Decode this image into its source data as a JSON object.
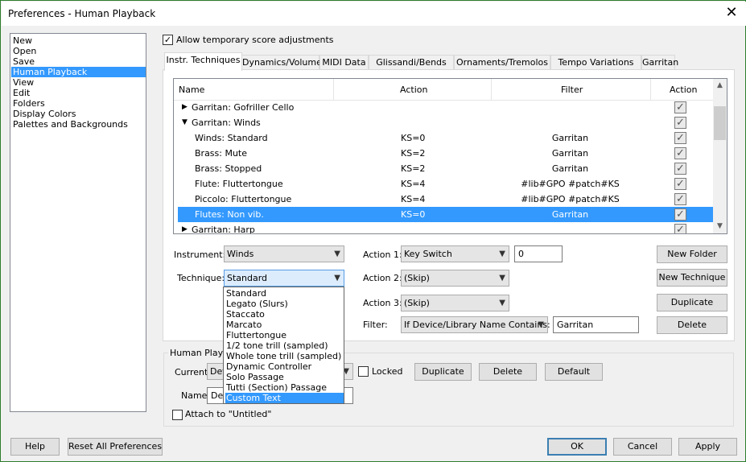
{
  "window": {
    "title": "Preferences - Human Playback",
    "close_icon": "close-icon"
  },
  "categories": [
    {
      "label": "New",
      "selected": false
    },
    {
      "label": "Open",
      "selected": false
    },
    {
      "label": "Save",
      "selected": false
    },
    {
      "label": "Human Playback",
      "selected": true
    },
    {
      "label": "View",
      "selected": false
    },
    {
      "label": "Edit",
      "selected": false
    },
    {
      "label": "Folders",
      "selected": false
    },
    {
      "label": "Display Colors",
      "selected": false
    },
    {
      "label": "Palettes and Backgrounds",
      "selected": false
    }
  ],
  "allow_temp": {
    "label": "Allow temporary score adjustments",
    "checked": true
  },
  "tabs": [
    {
      "label": "Instr. Techniques",
      "active": true
    },
    {
      "label": "Dynamics/Volume",
      "active": false
    },
    {
      "label": "MIDI Data",
      "active": false
    },
    {
      "label": "Glissandi/Bends",
      "active": false
    },
    {
      "label": "Ornaments/Tremolos",
      "active": false
    },
    {
      "label": "Tempo Variations",
      "active": false
    },
    {
      "label": "Garritan",
      "active": false
    }
  ],
  "grid": {
    "headers": {
      "name": "Name",
      "action": "Action",
      "filter": "Filter",
      "action2": "Action"
    },
    "rows": [
      {
        "expander": "▶",
        "name": "Garritan: Gofriller Cello",
        "action": "",
        "filter": "",
        "checked": true,
        "selected": false
      },
      {
        "expander": "▼",
        "name": "Garritan: Winds",
        "action": "",
        "filter": "",
        "checked": true,
        "selected": false
      },
      {
        "expander": "",
        "name": "Winds: Standard",
        "action": "KS=0",
        "filter": "Garritan",
        "checked": true,
        "selected": false
      },
      {
        "expander": "",
        "name": "Brass: Mute",
        "action": "KS=2",
        "filter": "Garritan",
        "checked": true,
        "selected": false
      },
      {
        "expander": "",
        "name": "Brass: Stopped",
        "action": "KS=2",
        "filter": "Garritan",
        "checked": true,
        "selected": false
      },
      {
        "expander": "",
        "name": "Flute: Fluttertongue",
        "action": "KS=4",
        "filter": "#lib#GPO #patch#KS",
        "checked": true,
        "selected": false
      },
      {
        "expander": "",
        "name": "Piccolo: Fluttertongue",
        "action": "KS=4",
        "filter": "#lib#GPO #patch#KS",
        "checked": true,
        "selected": false
      },
      {
        "expander": "",
        "name": "Flutes: Non vib.",
        "action": "KS=0",
        "filter": "Garritan",
        "checked": true,
        "selected": true
      },
      {
        "expander": "▶",
        "name": "Garritan: Harp",
        "action": "",
        "filter": "",
        "checked": true,
        "selected": false
      }
    ]
  },
  "form": {
    "instrument_label": "Instrument:",
    "instrument_value": "Winds",
    "technique_label": "Technique:",
    "technique_value": "Standard",
    "action1_label": "Action 1:",
    "action1_value": "Key Switch",
    "action1_number": "0",
    "action2_label": "Action 2:",
    "action2_value": "(Skip)",
    "action3_label": "Action 3:",
    "action3_value": "(Skip)",
    "filter_label": "Filter:",
    "filter_value": "If Device/Library Name Contains:",
    "filter_text": "Garritan",
    "new_folder": "New Folder",
    "new_technique": "New Technique",
    "duplicate": "Duplicate",
    "delete": "Delete"
  },
  "technique_options": [
    {
      "label": "Standard",
      "selected": false
    },
    {
      "label": "Legato (Slurs)",
      "selected": false
    },
    {
      "label": "Staccato",
      "selected": false
    },
    {
      "label": "Marcato",
      "selected": false
    },
    {
      "label": "Fluttertongue",
      "selected": false
    },
    {
      "label": "1/2 tone trill (sampled)",
      "selected": false
    },
    {
      "label": "Whole tone trill (sampled)",
      "selected": false
    },
    {
      "label": "Dynamic Controller",
      "selected": false
    },
    {
      "label": "Solo Passage",
      "selected": false
    },
    {
      "label": "Tutti (Section) Passage",
      "selected": false
    },
    {
      "label": "Custom Text",
      "selected": true
    }
  ],
  "style_group": {
    "title": "Human Playba",
    "current_label": "Current:",
    "current_value": "Def",
    "locked_label": "Locked",
    "duplicate": "Duplicate",
    "delete": "Delete",
    "default": "Default",
    "name_label": "Name:",
    "name_value": "Def",
    "attach_label": "Attach to \"Untitled\""
  },
  "footer": {
    "help": "Help",
    "reset": "Reset All Preferences",
    "ok": "OK",
    "cancel": "Cancel",
    "apply": "Apply"
  },
  "colors": {
    "selection": "#3399ff",
    "accent_border": "#3c7fb1"
  }
}
